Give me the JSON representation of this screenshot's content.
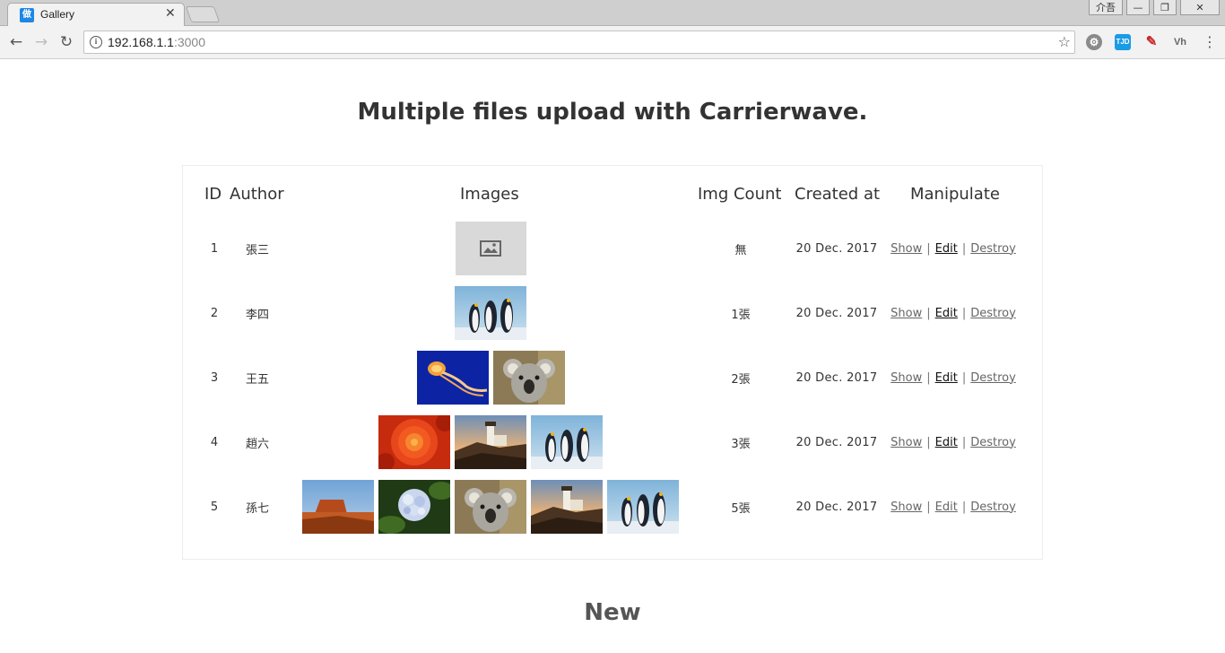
{
  "browser": {
    "tab_title": "Gallery",
    "tab_favicon_char": "做",
    "window_user_label": "介吾",
    "url_host": "192.168.1.1",
    "url_port": ":3000"
  },
  "page": {
    "title": "Multiple files upload with Carrierwave.",
    "new_heading": "New"
  },
  "table": {
    "headers": {
      "id": "ID",
      "author": "Author",
      "images": "Images",
      "img_count": "Img Count",
      "created_at": "Created at",
      "manipulate": "Manipulate"
    },
    "actions": {
      "show": "Show",
      "edit": "Edit",
      "destroy": "Destroy",
      "separator": "|"
    },
    "rows": [
      {
        "id": "1",
        "author": "張三",
        "img_count": "無",
        "created_at": "20 Dec. 2017",
        "images": [
          "placeholder"
        ]
      },
      {
        "id": "2",
        "author": "李四",
        "img_count": "1張",
        "created_at": "20 Dec. 2017",
        "images": [
          "penguins"
        ]
      },
      {
        "id": "3",
        "author": "王五",
        "img_count": "2張",
        "created_at": "20 Dec. 2017",
        "images": [
          "jellyfish",
          "koala"
        ]
      },
      {
        "id": "4",
        "author": "趙六",
        "img_count": "3張",
        "created_at": "20 Dec. 2017",
        "images": [
          "chrysanthemum",
          "lighthouse",
          "penguins"
        ]
      },
      {
        "id": "5",
        "author": "孫七",
        "img_count": "5張",
        "created_at": "20 Dec. 2017",
        "images": [
          "desert",
          "hydrangeas",
          "koala",
          "lighthouse",
          "penguins"
        ]
      }
    ]
  }
}
